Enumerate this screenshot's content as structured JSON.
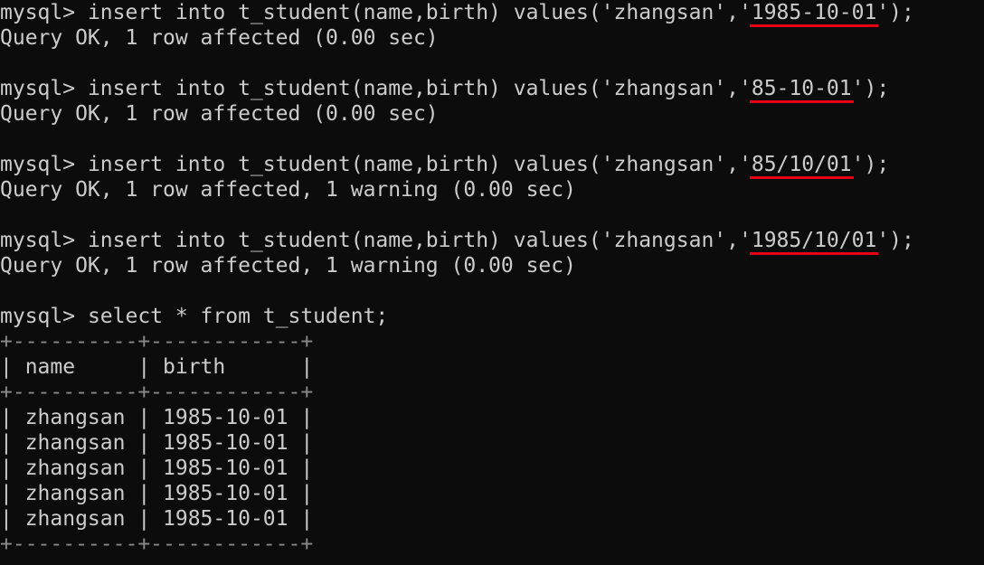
{
  "annotation_color": "#e60012",
  "terminal": {
    "commands": [
      {
        "prompt": "mysql> ",
        "before": "insert into t_student(name,birth) values('zhangsan','",
        "highlighted": "1985-10-01",
        "after": "');",
        "result": "Query OK, 1 row affected (0.00 sec)"
      },
      {
        "prompt": "mysql> ",
        "before": "insert into t_student(name,birth) values('zhangsan','",
        "highlighted": "85-10-01",
        "after": "');",
        "result": "Query OK, 1 row affected (0.00 sec)"
      },
      {
        "prompt": "mysql> ",
        "before": "insert into t_student(name,birth) values('zhangsan','",
        "highlighted": "85/10/01",
        "after": "');",
        "result": "Query OK, 1 row affected, 1 warning (0.00 sec)"
      },
      {
        "prompt": "mysql> ",
        "before": "insert into t_student(name,birth) values('zhangsan','",
        "highlighted": "1985/10/01",
        "after": "');",
        "result": "Query OK, 1 row affected, 1 warning (0.00 sec)"
      }
    ],
    "select": {
      "prompt": "mysql> ",
      "command": "select * from t_student;"
    },
    "table": {
      "border": "+----------+------------+",
      "header": "| name     | birth      |",
      "rows": [
        "| zhangsan | 1985-10-01 |",
        "| zhangsan | 1985-10-01 |",
        "| zhangsan | 1985-10-01 |",
        "| zhangsan | 1985-10-01 |",
        "| zhangsan | 1985-10-01 |"
      ]
    }
  }
}
